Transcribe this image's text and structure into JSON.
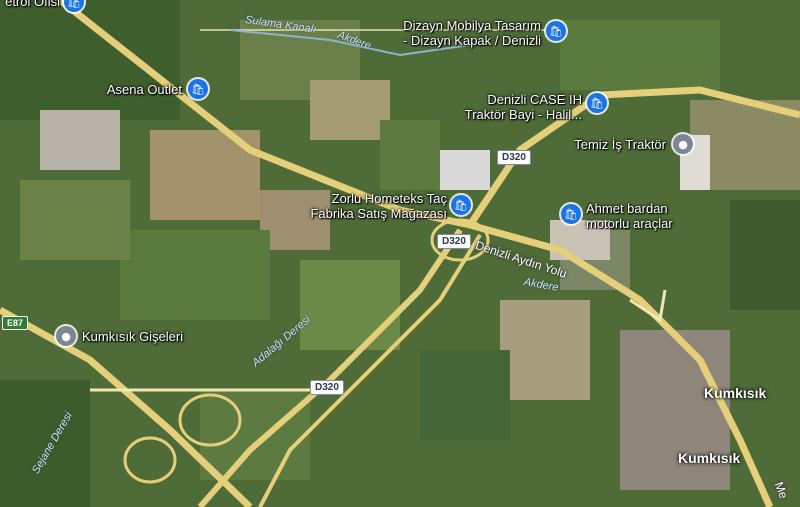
{
  "colors": {
    "shop_pin": "#1a73e8",
    "place_pin": "#7b8794",
    "highway": "#e6cf7a",
    "road": "#f3e7b0"
  },
  "pois": [
    {
      "label": "etrol Ofisi",
      "icon": "shopping-bag-icon",
      "kind": "shop"
    },
    {
      "label": "Dizayn Mobilya Tasarım\n- Dizayn Kapak / Denizli",
      "icon": "shopping-bag-icon",
      "kind": "shop"
    },
    {
      "label": "Asena Outlet",
      "icon": "shopping-bag-icon",
      "kind": "shop"
    },
    {
      "label": "Denizli CASE IH\nTraktör Bayi - Halil...",
      "icon": "shopping-bag-icon",
      "kind": "shop"
    },
    {
      "label": "Temiz İş Traktör",
      "icon": "location-pin-icon",
      "kind": "place"
    },
    {
      "label": "Zorlu Hometeks Taç\nFabrika Satış Mağazası",
      "icon": "shopping-bag-icon",
      "kind": "shop"
    },
    {
      "label": "Ahmet bardan\nmotorlu araçlar",
      "icon": "shopping-bag-icon",
      "kind": "shop"
    },
    {
      "label": "Kumkısık Gişeleri",
      "icon": "location-pin-icon",
      "kind": "place"
    }
  ],
  "roads": {
    "denizli_aydin": "Denizli Aydın Yolu",
    "shield_d320": "D320",
    "shield_e87": "E87",
    "shield_d320_east": "D320",
    "road_me": "Me"
  },
  "water": {
    "sulama": "Sulama Kanalı",
    "akdere_top": "Akdere",
    "akdere_mid": "Akdere",
    "adalagi": "Adalağı Deresi",
    "sejane": "Sejane Deresi"
  },
  "places": {
    "kumkisik_1": "Kumkısık",
    "kumkisik_2": "Kumkısık"
  }
}
